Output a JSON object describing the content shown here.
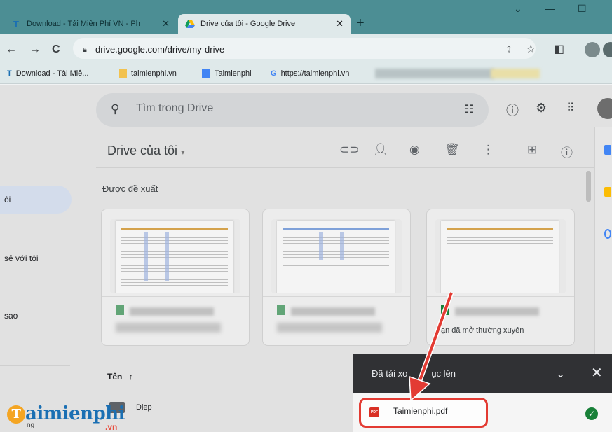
{
  "browser": {
    "tabs": [
      {
        "label": "Download - Tải Miễn Phí VN - Ph",
        "favicon": "T"
      },
      {
        "label": "Drive của tôi - Google Drive",
        "favicon": "drive-icon"
      }
    ],
    "url": "drive.google.com/drive/my-drive",
    "bookmarks": [
      "Download - Tải Miễ...",
      "taimienphi.vn",
      "Taimienphi",
      "https://taimienphi.vn"
    ]
  },
  "drive": {
    "search_placeholder": "Tìm trong Drive",
    "title": "Drive của tôi",
    "suggested_label": "Được đề xuất",
    "cards": [
      {
        "subtitle": ""
      },
      {
        "subtitle": ""
      },
      {
        "subtitle": "Bạn đã mở thường xuyên"
      }
    ],
    "card3_sub_visible": "ạn đã mở thường xuyên",
    "nav": {
      "active_partial": "ôi",
      "shared_partial": "sẻ với tôi",
      "starred_partial": "sao",
      "storage_partial": "ng"
    },
    "name_column": "Tên",
    "folder_name": "Diep"
  },
  "download": {
    "panel_title": "Đã tải xo",
    "panel_title_tail": "ục lên",
    "file_name": "Taimienphi.pdf",
    "status": "done"
  },
  "logo": {
    "text": "aimienphi",
    "initial": "T",
    "suffix": ".vn"
  },
  "colors": {
    "tab_strip": "#4c8e94",
    "annotation_red": "#e33b33",
    "drive_blue": "#1a73e8",
    "success_green": "#188038"
  }
}
